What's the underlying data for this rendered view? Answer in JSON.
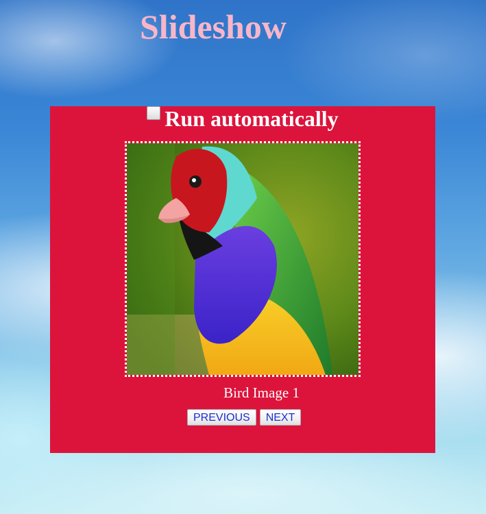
{
  "page": {
    "title": "Slideshow"
  },
  "slideshow": {
    "auto_label": "Run automatically",
    "auto_checked": false,
    "caption": "Bird Image 1",
    "image_subject": "bird"
  },
  "controls": {
    "previous_label": "PREVIOUS",
    "next_label": "NEXT"
  },
  "colors": {
    "title": "#f7b6c9",
    "panel": "#dc143c",
    "button_text": "#1a2fd0"
  }
}
